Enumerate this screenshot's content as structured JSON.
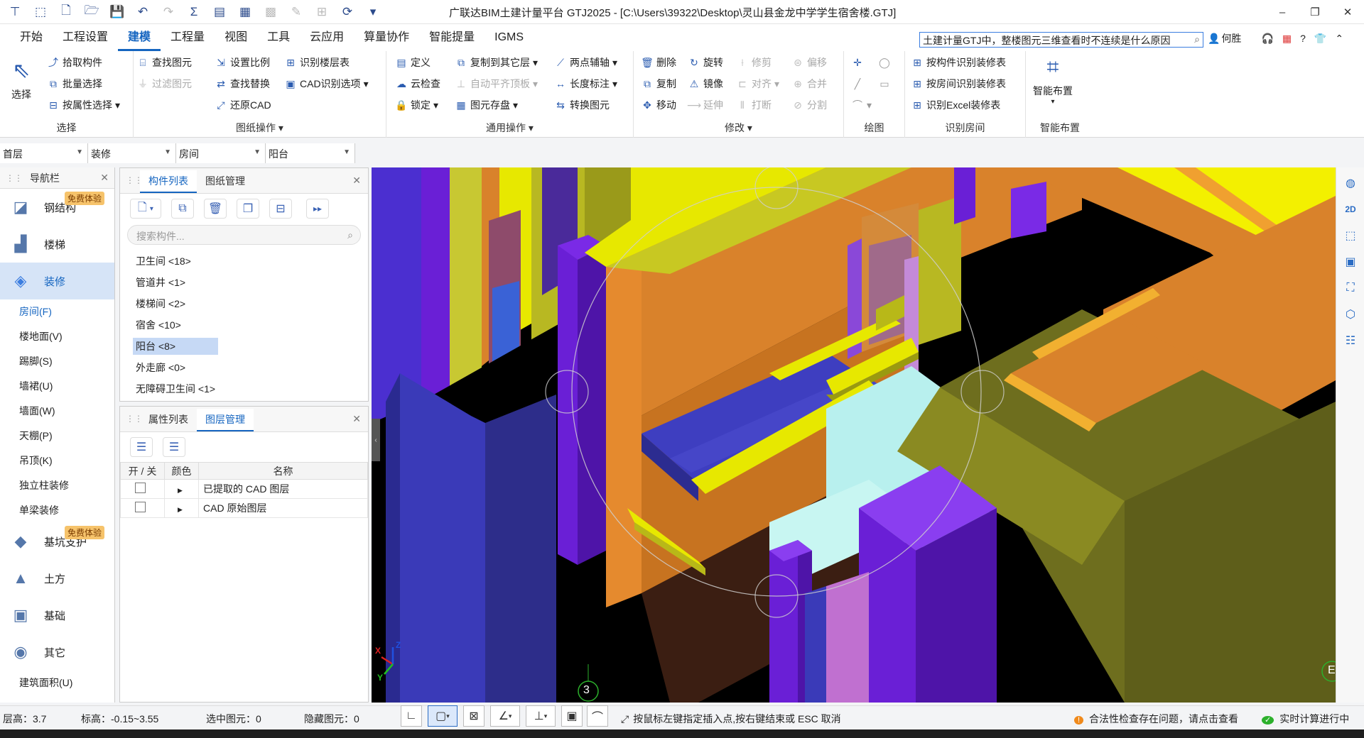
{
  "app": {
    "title": "广联达BIM土建计量平台 GTJ2025 - [C:\\Users\\39322\\Desktop\\灵山县金龙中学学生宿舍楼.GTJ]"
  },
  "menu": [
    "开始",
    "工程设置",
    "建模",
    "工程量",
    "视图",
    "工具",
    "云应用",
    "算量协作",
    "智能提量",
    "IGMS"
  ],
  "search": {
    "value": "土建计量GTJ中，整楼图元三维查看时不连续是什么原因"
  },
  "user": {
    "name": "何胜"
  },
  "ribbon": {
    "select_group": {
      "title": "选择",
      "select_label": "选择",
      "pick": "拾取构件",
      "batch": "批量选择",
      "by_attr": "按属性选择"
    },
    "drawing_ops": {
      "title": "图纸操作",
      "find_elem": "查找图元",
      "filter_elem": "过滤图元",
      "set_scale": "设置比例",
      "find_replace": "查找替换",
      "restore_cad": "还原CAD",
      "recog_floor": "识别楼层表",
      "cad_options": "CAD识别选项"
    },
    "common_ops": {
      "title": "通用操作",
      "define": "定义",
      "cloud_check": "云检查",
      "lock": "锁定",
      "copy_floor": "复制到其它层",
      "auto_level": "自动平齐顶板",
      "elem_store": "图元存盘",
      "two_point": "两点辅轴",
      "length_mark": "长度标注",
      "convert_elem": "转换图元"
    },
    "modify": {
      "title": "修改",
      "delete": "删除",
      "copy": "复制",
      "move": "移动",
      "rotate": "旋转",
      "mirror": "镜像",
      "extend": "延伸",
      "trim": "修剪",
      "align": "对齐",
      "break": "打断",
      "offset": "偏移",
      "merge": "合并",
      "split": "分割"
    },
    "draw": {
      "title": "绘图"
    },
    "recog_room": {
      "title": "识别房间",
      "by_comp": "按构件识别装修表",
      "by_room": "按房间识别装修表",
      "excel": "识别Excel装修表"
    },
    "smart": {
      "title": "智能布置",
      "label": "智能布置"
    }
  },
  "filters": [
    "首层",
    "装修",
    "房间",
    "阳台"
  ],
  "nav": {
    "title": "导航栏",
    "badge": "免费体验",
    "categories": [
      {
        "label": "钢结构",
        "icon": "steel-icon"
      },
      {
        "label": "楼梯",
        "icon": "stairs-icon"
      },
      {
        "label": "装修",
        "icon": "decoration-icon"
      }
    ],
    "subitems": [
      "房间(F)",
      "楼地面(V)",
      "踢脚(S)",
      "墙裙(U)",
      "墙面(W)",
      "天棚(P)",
      "吊顶(K)",
      "独立柱装修",
      "单梁装修"
    ],
    "categories2": [
      {
        "label": "基坑支护",
        "icon": "foundation-pit-icon"
      },
      {
        "label": "土方",
        "icon": "earthwork-icon"
      },
      {
        "label": "基础",
        "icon": "foundation-icon"
      },
      {
        "label": "其它",
        "icon": "other-icon"
      }
    ],
    "footer": "建筑面积(U)"
  },
  "comp_panel": {
    "tabs": [
      "构件列表",
      "图纸管理"
    ],
    "search_placeholder": "搜索构件...",
    "items": [
      "卫生间 <18>",
      "管道井 <1>",
      "楼梯间 <2>",
      "宿舍 <10>",
      "阳台 <8>",
      "外走廊 <0>",
      "无障碍卫生间 <1>"
    ],
    "selected": 4
  },
  "layer_panel": {
    "tabs": [
      "属性列表",
      "图层管理"
    ],
    "headers": [
      "开 / 关",
      "颜色",
      "名称"
    ],
    "rows": [
      "已提取的 CAD 图层",
      "CAD 原始图层"
    ]
  },
  "viewport": {
    "axis_number": "3",
    "axis_letter": "E",
    "axes": {
      "x": "X",
      "y": "Y",
      "z": "Z"
    }
  },
  "status": {
    "floor_height_label": "层高：",
    "floor_height": "3.7",
    "elev_label": "标高：",
    "elev": "-0.15~3.55",
    "selected_label": "选中图元：",
    "selected": "0",
    "hidden_label": "隐藏图元：",
    "hidden": "0",
    "hint": "按鼠标左键指定插入点,按右键结束或 ESC 取消",
    "check_warning": "合法性检查存在问题，请点击查看",
    "realtime": "实时计算进行中"
  },
  "colors": {
    "accent": "#1565c0",
    "wall_orange": "#d9822b",
    "wall_yellow": "#e8e800",
    "beam_blue": "#3a3ab8",
    "column_purple": "#6a1fd6",
    "olive": "#5e5e1a"
  }
}
